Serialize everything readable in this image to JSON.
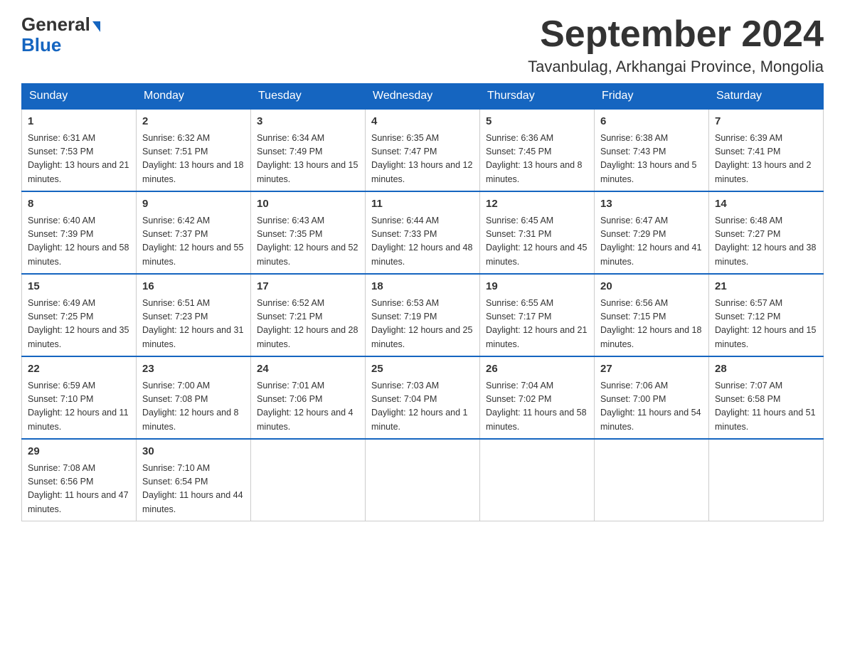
{
  "logo": {
    "text_general": "General",
    "text_blue": "Blue",
    "arrow": "▶"
  },
  "title": {
    "month_year": "September 2024",
    "location": "Tavanbulag, Arkhangai Province, Mongolia"
  },
  "headers": [
    "Sunday",
    "Monday",
    "Tuesday",
    "Wednesday",
    "Thursday",
    "Friday",
    "Saturday"
  ],
  "weeks": [
    [
      {
        "day": "1",
        "sunrise": "6:31 AM",
        "sunset": "7:53 PM",
        "daylight": "13 hours and 21 minutes."
      },
      {
        "day": "2",
        "sunrise": "6:32 AM",
        "sunset": "7:51 PM",
        "daylight": "13 hours and 18 minutes."
      },
      {
        "day": "3",
        "sunrise": "6:34 AM",
        "sunset": "7:49 PM",
        "daylight": "13 hours and 15 minutes."
      },
      {
        "day": "4",
        "sunrise": "6:35 AM",
        "sunset": "7:47 PM",
        "daylight": "13 hours and 12 minutes."
      },
      {
        "day": "5",
        "sunrise": "6:36 AM",
        "sunset": "7:45 PM",
        "daylight": "13 hours and 8 minutes."
      },
      {
        "day": "6",
        "sunrise": "6:38 AM",
        "sunset": "7:43 PM",
        "daylight": "13 hours and 5 minutes."
      },
      {
        "day": "7",
        "sunrise": "6:39 AM",
        "sunset": "7:41 PM",
        "daylight": "13 hours and 2 minutes."
      }
    ],
    [
      {
        "day": "8",
        "sunrise": "6:40 AM",
        "sunset": "7:39 PM",
        "daylight": "12 hours and 58 minutes."
      },
      {
        "day": "9",
        "sunrise": "6:42 AM",
        "sunset": "7:37 PM",
        "daylight": "12 hours and 55 minutes."
      },
      {
        "day": "10",
        "sunrise": "6:43 AM",
        "sunset": "7:35 PM",
        "daylight": "12 hours and 52 minutes."
      },
      {
        "day": "11",
        "sunrise": "6:44 AM",
        "sunset": "7:33 PM",
        "daylight": "12 hours and 48 minutes."
      },
      {
        "day": "12",
        "sunrise": "6:45 AM",
        "sunset": "7:31 PM",
        "daylight": "12 hours and 45 minutes."
      },
      {
        "day": "13",
        "sunrise": "6:47 AM",
        "sunset": "7:29 PM",
        "daylight": "12 hours and 41 minutes."
      },
      {
        "day": "14",
        "sunrise": "6:48 AM",
        "sunset": "7:27 PM",
        "daylight": "12 hours and 38 minutes."
      }
    ],
    [
      {
        "day": "15",
        "sunrise": "6:49 AM",
        "sunset": "7:25 PM",
        "daylight": "12 hours and 35 minutes."
      },
      {
        "day": "16",
        "sunrise": "6:51 AM",
        "sunset": "7:23 PM",
        "daylight": "12 hours and 31 minutes."
      },
      {
        "day": "17",
        "sunrise": "6:52 AM",
        "sunset": "7:21 PM",
        "daylight": "12 hours and 28 minutes."
      },
      {
        "day": "18",
        "sunrise": "6:53 AM",
        "sunset": "7:19 PM",
        "daylight": "12 hours and 25 minutes."
      },
      {
        "day": "19",
        "sunrise": "6:55 AM",
        "sunset": "7:17 PM",
        "daylight": "12 hours and 21 minutes."
      },
      {
        "day": "20",
        "sunrise": "6:56 AM",
        "sunset": "7:15 PM",
        "daylight": "12 hours and 18 minutes."
      },
      {
        "day": "21",
        "sunrise": "6:57 AM",
        "sunset": "7:12 PM",
        "daylight": "12 hours and 15 minutes."
      }
    ],
    [
      {
        "day": "22",
        "sunrise": "6:59 AM",
        "sunset": "7:10 PM",
        "daylight": "12 hours and 11 minutes."
      },
      {
        "day": "23",
        "sunrise": "7:00 AM",
        "sunset": "7:08 PM",
        "daylight": "12 hours and 8 minutes."
      },
      {
        "day": "24",
        "sunrise": "7:01 AM",
        "sunset": "7:06 PM",
        "daylight": "12 hours and 4 minutes."
      },
      {
        "day": "25",
        "sunrise": "7:03 AM",
        "sunset": "7:04 PM",
        "daylight": "12 hours and 1 minute."
      },
      {
        "day": "26",
        "sunrise": "7:04 AM",
        "sunset": "7:02 PM",
        "daylight": "11 hours and 58 minutes."
      },
      {
        "day": "27",
        "sunrise": "7:06 AM",
        "sunset": "7:00 PM",
        "daylight": "11 hours and 54 minutes."
      },
      {
        "day": "28",
        "sunrise": "7:07 AM",
        "sunset": "6:58 PM",
        "daylight": "11 hours and 51 minutes."
      }
    ],
    [
      {
        "day": "29",
        "sunrise": "7:08 AM",
        "sunset": "6:56 PM",
        "daylight": "11 hours and 47 minutes."
      },
      {
        "day": "30",
        "sunrise": "7:10 AM",
        "sunset": "6:54 PM",
        "daylight": "11 hours and 44 minutes."
      },
      null,
      null,
      null,
      null,
      null
    ]
  ]
}
